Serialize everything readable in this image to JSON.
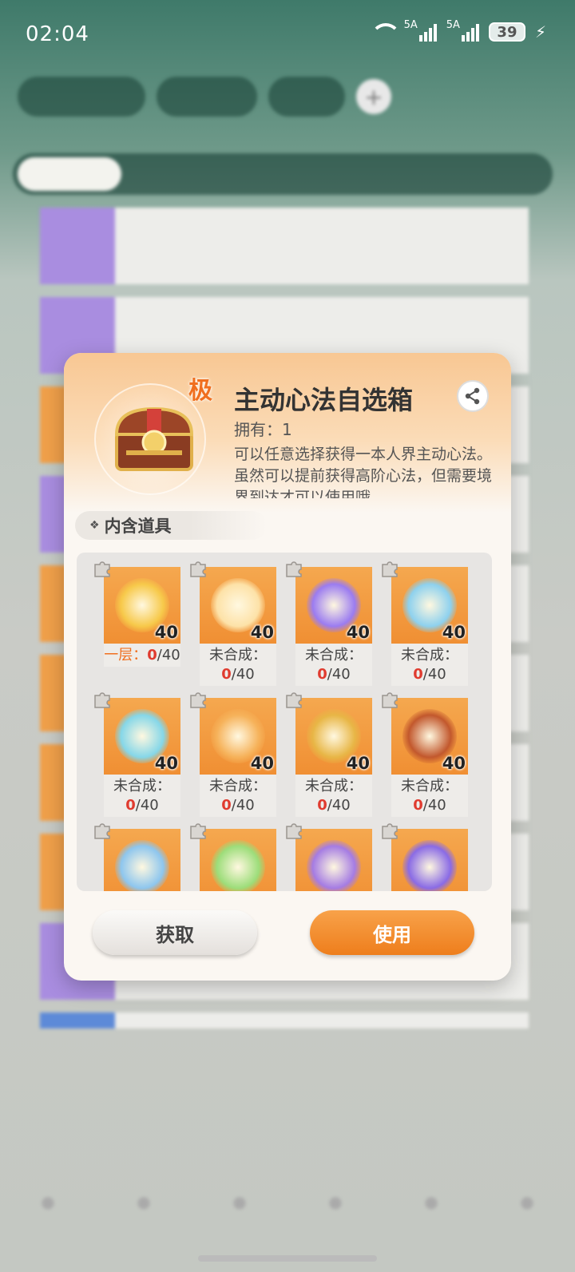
{
  "status_bar": {
    "time": "02:04",
    "network_1": "5A",
    "network_2": "5A",
    "battery": "39"
  },
  "modal": {
    "grade_badge": "极",
    "title": "主动心法自选箱",
    "owned": "拥有：1",
    "description": "可以任意选择获得一本人界主动心法。虽然可以提前获得高阶心法，但需要境界到达才可以使用哦。",
    "section_label": "内含道具",
    "items": [
      {
        "level": "40",
        "status": "一层：",
        "current": "0",
        "total": "/40",
        "first": true,
        "color": "#f7c94a",
        "icon": "golden-meditation-icon"
      },
      {
        "level": "40",
        "status": "未合成：",
        "current": "0",
        "total": "/40",
        "first": false,
        "color": "#fde2a8",
        "icon": "lotus-light-icon"
      },
      {
        "level": "40",
        "status": "未合成：",
        "current": "0",
        "total": "/40",
        "first": false,
        "color": "#9b7cf0",
        "icon": "purple-orb-icon"
      },
      {
        "level": "40",
        "status": "未合成：",
        "current": "0",
        "total": "/40",
        "first": false,
        "color": "#8ed1ee",
        "icon": "lightning-figure-icon"
      },
      {
        "level": "40",
        "status": "未合成：",
        "current": "0",
        "total": "/40",
        "first": false,
        "color": "#86d7e8",
        "icon": "ice-meditation-icon"
      },
      {
        "level": "40",
        "status": "未合成：",
        "current": "0",
        "total": "/40",
        "first": false,
        "color": "#f6b25a",
        "icon": "fire-aura-icon"
      },
      {
        "level": "40",
        "status": "未合成：",
        "current": "0",
        "total": "/40",
        "first": false,
        "color": "#e8b646",
        "icon": "golden-orb-icon"
      },
      {
        "level": "40",
        "status": "未合成：",
        "current": "0",
        "total": "/40",
        "first": false,
        "color": "#c2582d",
        "icon": "thorn-figure-icon"
      },
      {
        "level": "",
        "status": "",
        "current": "",
        "total": "",
        "first": false,
        "color": "#8ec6ee",
        "icon": "water-figure-icon"
      },
      {
        "level": "",
        "status": "",
        "current": "",
        "total": "",
        "first": false,
        "color": "#9ddd7a",
        "icon": "wood-crystal-icon"
      },
      {
        "level": "",
        "status": "",
        "current": "",
        "total": "",
        "first": false,
        "color": "#a57ce3",
        "icon": "dance-figure-icon"
      },
      {
        "level": "",
        "status": "",
        "current": "",
        "total": "",
        "first": false,
        "color": "#8a6be5",
        "icon": "purple-flame-icon"
      }
    ],
    "buttons": {
      "get": "获取",
      "use": "使用"
    }
  },
  "colors": {
    "accent_orange": "#ee7e1c",
    "highlight_red": "#e03b2f",
    "grade_orange": "#f06f1f"
  }
}
